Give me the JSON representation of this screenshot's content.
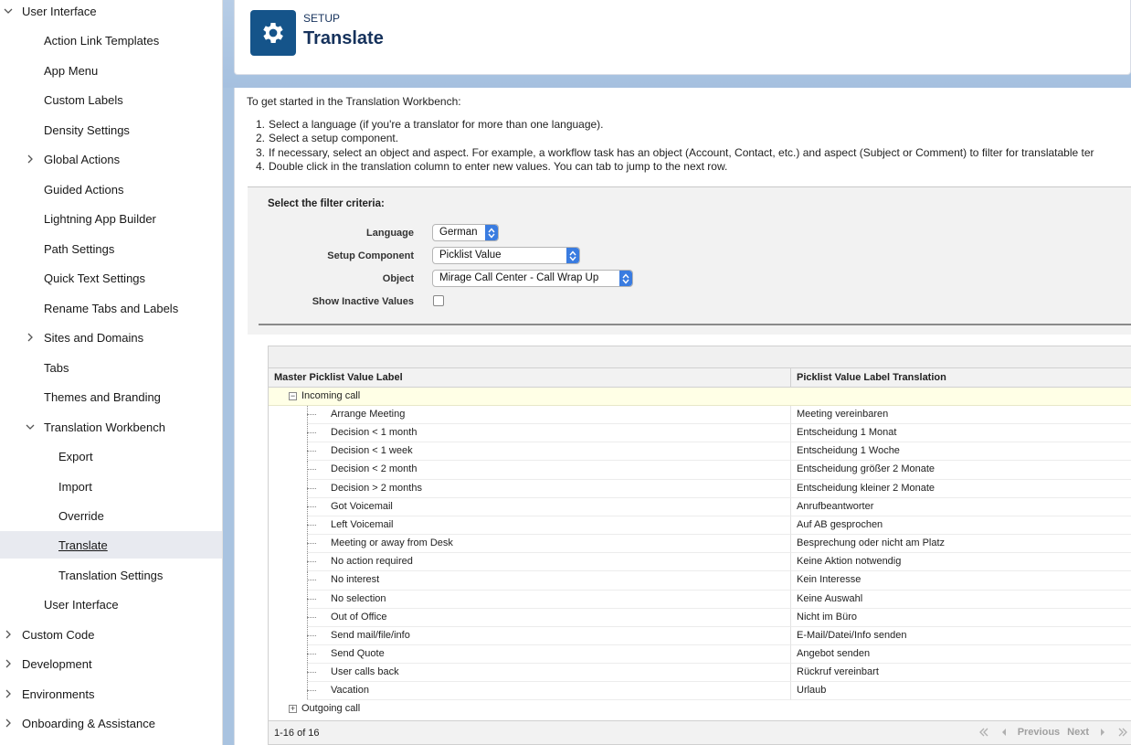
{
  "sidebar": {
    "items": [
      {
        "label": "User Interface",
        "chevron": "down"
      },
      {
        "label": "Action Link Templates"
      },
      {
        "label": "App Menu"
      },
      {
        "label": "Custom Labels"
      },
      {
        "label": "Density Settings"
      },
      {
        "label": "Global Actions",
        "chevron": "right"
      },
      {
        "label": "Guided Actions"
      },
      {
        "label": "Lightning App Builder"
      },
      {
        "label": "Path Settings"
      },
      {
        "label": "Quick Text Settings"
      },
      {
        "label": "Rename Tabs and Labels"
      },
      {
        "label": "Sites and Domains",
        "chevron": "right"
      },
      {
        "label": "Tabs"
      },
      {
        "label": "Themes and Branding"
      },
      {
        "label": "Translation Workbench",
        "chevron": "down"
      },
      {
        "label": "Export"
      },
      {
        "label": "Import"
      },
      {
        "label": "Override"
      },
      {
        "label": "Translate",
        "active": true
      },
      {
        "label": "Translation Settings"
      },
      {
        "label": "User Interface"
      },
      {
        "label": "Custom Code",
        "chevron": "right"
      },
      {
        "label": "Development",
        "chevron": "right"
      },
      {
        "label": "Environments",
        "chevron": "right"
      },
      {
        "label": "Onboarding & Assistance",
        "chevron": "right"
      }
    ]
  },
  "header": {
    "icon": "gear-icon",
    "breadcrumb": "SETUP",
    "title": "Translate"
  },
  "intro": {
    "text": "To get started in the Translation Workbench:",
    "steps": [
      {
        "num": "1.",
        "text": "Select a language (if you're a translator for more than one language)."
      },
      {
        "num": "2.",
        "text": "Select a setup component."
      },
      {
        "num": "3.",
        "text": "If necessary, select an object and aspect. For example, a workflow task has an object (Account, Contact, etc.) and aspect (Subject or Comment) to filter for translatable ter"
      },
      {
        "num": "4.",
        "text": "Double click in the translation column to enter new values. You can tab to jump to the next row."
      }
    ]
  },
  "filter": {
    "title": "Select the filter criteria:",
    "language_label": "Language",
    "language_value": "German",
    "component_label": "Setup Component",
    "component_value": "Picklist Value",
    "object_label": "Object",
    "object_value": "Mirage Call Center - Call Wrap Up",
    "inactive_label": "Show Inactive Values",
    "inactive_checked": false
  },
  "table": {
    "col1": "Master Picklist Value Label",
    "col2": "Picklist Value Label Translation",
    "group1": {
      "toggle": "−",
      "label": "Incoming call"
    },
    "rows": [
      {
        "master": "Arrange Meeting",
        "translation": "Meeting vereinbaren"
      },
      {
        "master": "Decision < 1 month",
        "translation": "Entscheidung 1 Monat"
      },
      {
        "master": "Decision < 1 week",
        "translation": "Entscheidung 1 Woche"
      },
      {
        "master": "Decision < 2 month",
        "translation": "Entscheidung größer 2 Monate"
      },
      {
        "master": "Decision > 2 months",
        "translation": "Entscheidung kleiner 2 Monate"
      },
      {
        "master": "Got Voicemail",
        "translation": "Anrufbeantworter"
      },
      {
        "master": "Left Voicemail",
        "translation": "Auf AB gesprochen"
      },
      {
        "master": "Meeting or away from Desk",
        "translation": "Besprechung oder nicht am Platz"
      },
      {
        "master": "No action required",
        "translation": "Keine Aktion notwendig"
      },
      {
        "master": "No interest",
        "translation": "Kein Interesse"
      },
      {
        "master": "No selection",
        "translation": "Keine Auswahl"
      },
      {
        "master": "Out of Office",
        "translation": "Nicht im Büro"
      },
      {
        "master": "Send mail/file/info",
        "translation": "E-Mail/Datei/Info senden"
      },
      {
        "master": "Send Quote",
        "translation": "Angebot senden"
      },
      {
        "master": "User calls back",
        "translation": "Rückruf vereinbart"
      },
      {
        "master": "Vacation",
        "translation": "Urlaub"
      }
    ],
    "group2": {
      "toggle": "+",
      "label": "Outgoing call"
    },
    "count": "1-16 of 16",
    "previous": "Previous",
    "next": "Next"
  },
  "colors": {
    "brand": "#15548a",
    "header_text": "#16325c",
    "select_arrow": "#3a7ce0"
  }
}
